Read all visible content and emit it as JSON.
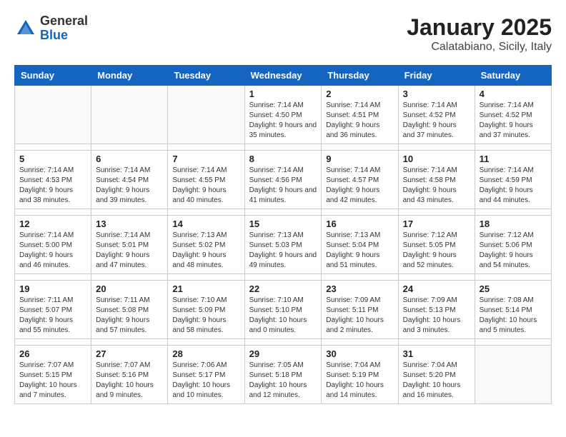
{
  "header": {
    "logo_general": "General",
    "logo_blue": "Blue",
    "title": "January 2025",
    "subtitle": "Calatabiano, Sicily, Italy"
  },
  "days_of_week": [
    "Sunday",
    "Monday",
    "Tuesday",
    "Wednesday",
    "Thursday",
    "Friday",
    "Saturday"
  ],
  "weeks": [
    {
      "days": [
        {
          "num": "",
          "info": ""
        },
        {
          "num": "",
          "info": ""
        },
        {
          "num": "",
          "info": ""
        },
        {
          "num": "1",
          "info": "Sunrise: 7:14 AM\nSunset: 4:50 PM\nDaylight: 9 hours and 35 minutes."
        },
        {
          "num": "2",
          "info": "Sunrise: 7:14 AM\nSunset: 4:51 PM\nDaylight: 9 hours and 36 minutes."
        },
        {
          "num": "3",
          "info": "Sunrise: 7:14 AM\nSunset: 4:52 PM\nDaylight: 9 hours and 37 minutes."
        },
        {
          "num": "4",
          "info": "Sunrise: 7:14 AM\nSunset: 4:52 PM\nDaylight: 9 hours and 37 minutes."
        }
      ]
    },
    {
      "days": [
        {
          "num": "5",
          "info": "Sunrise: 7:14 AM\nSunset: 4:53 PM\nDaylight: 9 hours and 38 minutes."
        },
        {
          "num": "6",
          "info": "Sunrise: 7:14 AM\nSunset: 4:54 PM\nDaylight: 9 hours and 39 minutes."
        },
        {
          "num": "7",
          "info": "Sunrise: 7:14 AM\nSunset: 4:55 PM\nDaylight: 9 hours and 40 minutes."
        },
        {
          "num": "8",
          "info": "Sunrise: 7:14 AM\nSunset: 4:56 PM\nDaylight: 9 hours and 41 minutes."
        },
        {
          "num": "9",
          "info": "Sunrise: 7:14 AM\nSunset: 4:57 PM\nDaylight: 9 hours and 42 minutes."
        },
        {
          "num": "10",
          "info": "Sunrise: 7:14 AM\nSunset: 4:58 PM\nDaylight: 9 hours and 43 minutes."
        },
        {
          "num": "11",
          "info": "Sunrise: 7:14 AM\nSunset: 4:59 PM\nDaylight: 9 hours and 44 minutes."
        }
      ]
    },
    {
      "days": [
        {
          "num": "12",
          "info": "Sunrise: 7:14 AM\nSunset: 5:00 PM\nDaylight: 9 hours and 46 minutes."
        },
        {
          "num": "13",
          "info": "Sunrise: 7:14 AM\nSunset: 5:01 PM\nDaylight: 9 hours and 47 minutes."
        },
        {
          "num": "14",
          "info": "Sunrise: 7:13 AM\nSunset: 5:02 PM\nDaylight: 9 hours and 48 minutes."
        },
        {
          "num": "15",
          "info": "Sunrise: 7:13 AM\nSunset: 5:03 PM\nDaylight: 9 hours and 49 minutes."
        },
        {
          "num": "16",
          "info": "Sunrise: 7:13 AM\nSunset: 5:04 PM\nDaylight: 9 hours and 51 minutes."
        },
        {
          "num": "17",
          "info": "Sunrise: 7:12 AM\nSunset: 5:05 PM\nDaylight: 9 hours and 52 minutes."
        },
        {
          "num": "18",
          "info": "Sunrise: 7:12 AM\nSunset: 5:06 PM\nDaylight: 9 hours and 54 minutes."
        }
      ]
    },
    {
      "days": [
        {
          "num": "19",
          "info": "Sunrise: 7:11 AM\nSunset: 5:07 PM\nDaylight: 9 hours and 55 minutes."
        },
        {
          "num": "20",
          "info": "Sunrise: 7:11 AM\nSunset: 5:08 PM\nDaylight: 9 hours and 57 minutes."
        },
        {
          "num": "21",
          "info": "Sunrise: 7:10 AM\nSunset: 5:09 PM\nDaylight: 9 hours and 58 minutes."
        },
        {
          "num": "22",
          "info": "Sunrise: 7:10 AM\nSunset: 5:10 PM\nDaylight: 10 hours and 0 minutes."
        },
        {
          "num": "23",
          "info": "Sunrise: 7:09 AM\nSunset: 5:11 PM\nDaylight: 10 hours and 2 minutes."
        },
        {
          "num": "24",
          "info": "Sunrise: 7:09 AM\nSunset: 5:13 PM\nDaylight: 10 hours and 3 minutes."
        },
        {
          "num": "25",
          "info": "Sunrise: 7:08 AM\nSunset: 5:14 PM\nDaylight: 10 hours and 5 minutes."
        }
      ]
    },
    {
      "days": [
        {
          "num": "26",
          "info": "Sunrise: 7:07 AM\nSunset: 5:15 PM\nDaylight: 10 hours and 7 minutes."
        },
        {
          "num": "27",
          "info": "Sunrise: 7:07 AM\nSunset: 5:16 PM\nDaylight: 10 hours and 9 minutes."
        },
        {
          "num": "28",
          "info": "Sunrise: 7:06 AM\nSunset: 5:17 PM\nDaylight: 10 hours and 10 minutes."
        },
        {
          "num": "29",
          "info": "Sunrise: 7:05 AM\nSunset: 5:18 PM\nDaylight: 10 hours and 12 minutes."
        },
        {
          "num": "30",
          "info": "Sunrise: 7:04 AM\nSunset: 5:19 PM\nDaylight: 10 hours and 14 minutes."
        },
        {
          "num": "31",
          "info": "Sunrise: 7:04 AM\nSunset: 5:20 PM\nDaylight: 10 hours and 16 minutes."
        },
        {
          "num": "",
          "info": ""
        }
      ]
    }
  ]
}
